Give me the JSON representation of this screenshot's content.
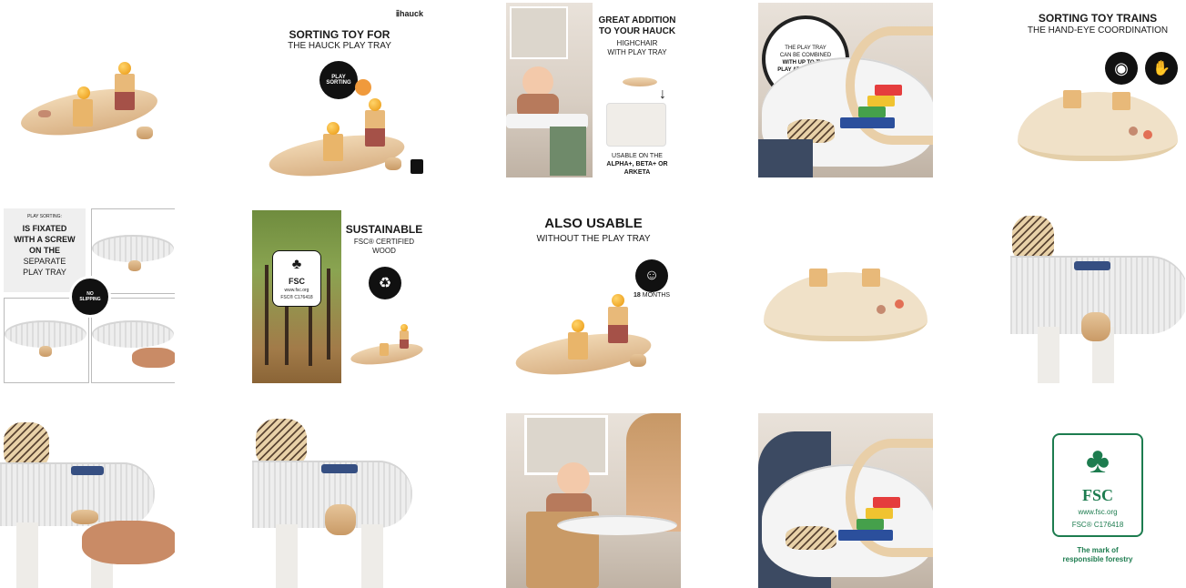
{
  "tiles": {
    "t2": {
      "brand": "hauck",
      "title": "SORTING TOY FOR",
      "subtitle": "THE HAUCK PLAY TRAY",
      "badge_line1": "PLAY",
      "badge_line2": "SORTING"
    },
    "t3": {
      "title_line1": "GREAT ADDITION",
      "title_line2": "TO YOUR HAUCK",
      "sub_line1": "HIGHCHAIR",
      "sub_line2": "WITH PLAY TRAY",
      "usable_line1": "USABLE ON THE",
      "usable_line2": "ALPHA+, BETA+ OR",
      "usable_line3": "ARKETA"
    },
    "t4": {
      "line1": "THE PLAY TRAY",
      "line2": "CAN BE COMBINED",
      "line3": "WITH UP TO TWO",
      "line4": "PLAY ATTACHMENTS"
    },
    "t5": {
      "title": "SORTING TOY TRAINS",
      "subtitle": "THE HAND-EYE COORDINATION"
    },
    "t6": {
      "small": "PLAY SORTING:",
      "line1": "IS FIXATED",
      "line2": "WITH A SCREW",
      "line3": "ON THE",
      "line4": "SEPARATE",
      "line5": "PLAY TRAY",
      "badge_line1": "NO",
      "badge_line2": "SLIPPING"
    },
    "t7": {
      "title": "SUSTAINABLE",
      "sub_line1": "FSC® CERTIFIED",
      "sub_line2": "WOOD",
      "fsc_label": "FSC",
      "fsc_url": "www.fsc.org",
      "fsc_code": "FSC® C176418"
    },
    "t8": {
      "title": "ALSO USABLE",
      "subtitle": "WITHOUT THE PLAY TRAY",
      "age_value": "18",
      "age_unit": "MONTHS"
    },
    "t15": {
      "fsc_label": "FSC",
      "fsc_url": "www.fsc.org",
      "fsc_code": "FSC® C176418",
      "tagline_line1": "The mark of",
      "tagline_line2": "responsible forestry"
    }
  },
  "colors": {
    "fsc_green": "#1d7c4f",
    "badge_black": "#111111",
    "wood": "#e3c197",
    "orange": "#e9950e"
  },
  "icons": [
    "eye-icon",
    "hand-icon",
    "child-face-icon",
    "recycle-globe-icon",
    "tree-check-icon",
    "hauck-logo-icon"
  ]
}
